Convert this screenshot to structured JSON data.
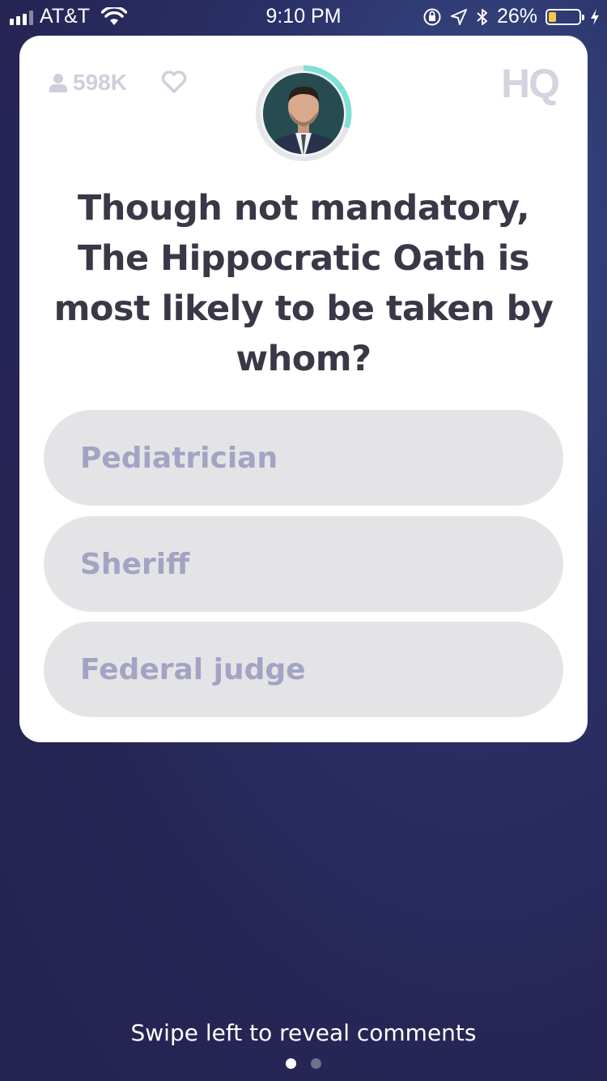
{
  "status_bar": {
    "carrier": "AT&T",
    "time": "9:10 PM",
    "battery": "26%",
    "battery_level": 0.26
  },
  "card": {
    "viewer_count": "598K",
    "logo": "HQ",
    "host_timer_progress": 0.3,
    "question": "Though not mandatory, The Hippocratic Oath is most likely to be taken by whom?",
    "answers": [
      {
        "label": "Pediatrician"
      },
      {
        "label": "Sheriff"
      },
      {
        "label": "Federal judge"
      }
    ]
  },
  "footer": {
    "swipe_hint": "Swipe left to reveal comments",
    "page_indicator": {
      "current": 1,
      "total": 2
    }
  },
  "icons": [
    "signal-icon",
    "wifi-icon",
    "orientation-lock-icon",
    "location-icon",
    "bluetooth-icon",
    "battery-icon",
    "charging-icon",
    "user-icon",
    "heart-icon"
  ],
  "colors": {
    "background": "#262555",
    "card": "#ffffff",
    "answer_bg": "#e4e4e6",
    "answer_text": "#a3a3c4",
    "question_text": "#3a3847",
    "timer_ring": "#7fe0d5",
    "battery_fill": "#f7c948"
  }
}
